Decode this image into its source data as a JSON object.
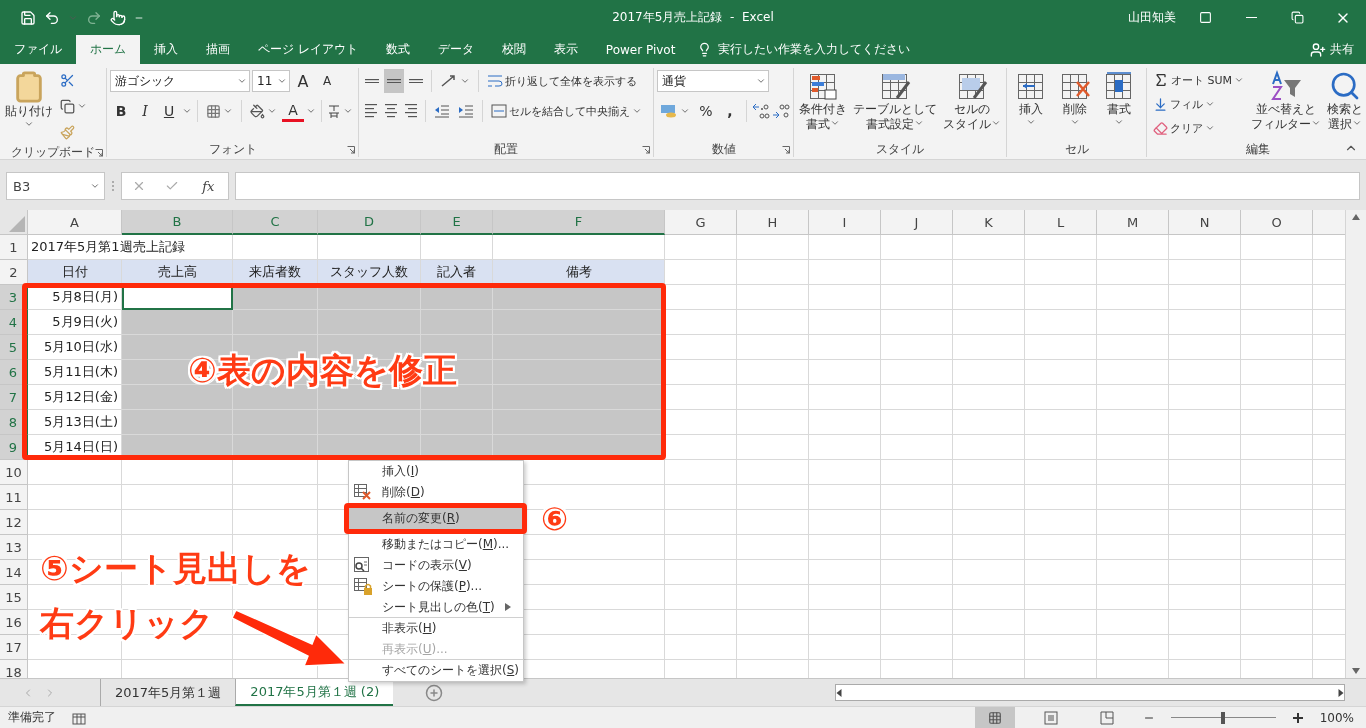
{
  "title_bar": {
    "title": "2017年5月売上記録  -  Excel",
    "user": "山田知美"
  },
  "menu_tabs": [
    {
      "label": "ファイル",
      "selected": false
    },
    {
      "label": "ホーム",
      "selected": true
    },
    {
      "label": "挿入",
      "selected": false
    },
    {
      "label": "描画",
      "selected": false
    },
    {
      "label": "ページ レイアウト",
      "selected": false
    },
    {
      "label": "数式",
      "selected": false
    },
    {
      "label": "データ",
      "selected": false
    },
    {
      "label": "校閲",
      "selected": false
    },
    {
      "label": "表示",
      "selected": false
    },
    {
      "label": "Power Pivot",
      "selected": false
    }
  ],
  "tell_me": {
    "placeholder": "実行したい作業を入力してください"
  },
  "share": "共有",
  "ribbon": {
    "clipboard": {
      "paste": "貼り付け",
      "label": "クリップボード"
    },
    "font": {
      "name": "游ゴシック",
      "size": "11",
      "grow": "A",
      "shrink": "A",
      "bold": "B",
      "italic": "I",
      "underline": "U",
      "color_glyph": "A",
      "label": "フォント"
    },
    "alignment": {
      "wrap": "折り返して全体を表示する",
      "merge": "セルを結合して中央揃え",
      "label": "配置"
    },
    "number": {
      "format": "通貨",
      "percent": "%",
      "comma": ",",
      "label": "数値"
    },
    "styles": {
      "label": "スタイル",
      "buttons": [
        {
          "kind": "conditional",
          "lines": [
            "条件付き",
            "書式"
          ]
        },
        {
          "kind": "table",
          "lines": [
            "テーブルとして",
            "書式設定"
          ]
        },
        {
          "kind": "cellstyle",
          "lines": [
            "セルの",
            "スタイル"
          ]
        }
      ]
    },
    "cells": {
      "label": "セル",
      "buttons": [
        {
          "kind": "insert",
          "lines": [
            "挿入"
          ]
        },
        {
          "kind": "delete",
          "lines": [
            "削除"
          ]
        },
        {
          "kind": "format",
          "lines": [
            "書式"
          ]
        }
      ]
    },
    "editing": {
      "label": "編集",
      "autosum": "オート SUM",
      "fill": "フィル",
      "clear": "クリア",
      "buttons": [
        {
          "kind": "sort",
          "lines": [
            "並べ替えと",
            "フィルター"
          ]
        },
        {
          "kind": "find",
          "lines": [
            "検索と",
            "選択"
          ]
        }
      ]
    }
  },
  "formula_bar": {
    "name_box": "B3",
    "function_label": "fx"
  },
  "grid": {
    "columns": [
      {
        "label": "A",
        "selected": false,
        "active": false
      },
      {
        "label": "B",
        "selected": true,
        "active": true
      },
      {
        "label": "C",
        "selected": true,
        "active": false
      },
      {
        "label": "D",
        "selected": true,
        "active": false
      },
      {
        "label": "E",
        "selected": true,
        "active": false
      },
      {
        "label": "F",
        "selected": true,
        "active": false
      },
      {
        "label": "G",
        "selected": false,
        "active": false
      },
      {
        "label": "H",
        "selected": false,
        "active": false
      },
      {
        "label": "I",
        "selected": false,
        "active": false
      },
      {
        "label": "J",
        "selected": false,
        "active": false
      },
      {
        "label": "K",
        "selected": false,
        "active": false
      },
      {
        "label": "L",
        "selected": false,
        "active": false
      },
      {
        "label": "M",
        "selected": false,
        "active": false
      },
      {
        "label": "N",
        "selected": false,
        "active": false
      },
      {
        "label": "O",
        "selected": false,
        "active": false
      }
    ],
    "rows": [
      {
        "num": "1",
        "kind": "title",
        "selected": false,
        "cells": [
          "2017年5月第1週売上記録"
        ]
      },
      {
        "num": "2",
        "kind": "header",
        "selected": false,
        "cells": [
          "日付",
          "売上高",
          "来店者数",
          "スタッフ人数",
          "記入者",
          "備考"
        ]
      },
      {
        "num": "3",
        "kind": "data",
        "selected": true,
        "cells": [
          "5月8日(月)"
        ]
      },
      {
        "num": "4",
        "kind": "data",
        "selected": true,
        "cells": [
          "5月9日(火)"
        ]
      },
      {
        "num": "5",
        "kind": "data",
        "selected": true,
        "cells": [
          "5月10日(水)"
        ]
      },
      {
        "num": "6",
        "kind": "data",
        "selected": true,
        "cells": [
          "5月11日(木)"
        ]
      },
      {
        "num": "7",
        "kind": "data",
        "selected": true,
        "cells": [
          "5月12日(金)"
        ]
      },
      {
        "num": "8",
        "kind": "data",
        "selected": true,
        "cells": [
          "5月13日(土)"
        ]
      },
      {
        "num": "9",
        "kind": "data",
        "selected": true,
        "cells": [
          "5月14日(日)"
        ]
      },
      {
        "num": "10",
        "kind": "empty",
        "selected": false
      },
      {
        "num": "11",
        "kind": "empty",
        "selected": false
      },
      {
        "num": "12",
        "kind": "empty",
        "selected": false
      },
      {
        "num": "13",
        "kind": "empty",
        "selected": false
      },
      {
        "num": "14",
        "kind": "empty",
        "selected": false
      },
      {
        "num": "15",
        "kind": "empty",
        "selected": false
      },
      {
        "num": "16",
        "kind": "empty",
        "selected": false
      },
      {
        "num": "17",
        "kind": "empty",
        "selected": false
      },
      {
        "num": "18",
        "kind": "empty",
        "selected": false
      }
    ]
  },
  "context_menu": {
    "items": [
      {
        "before": "挿入(",
        "key": "I",
        "after": ")",
        "kind": "plain",
        "selected": false,
        "disabled": false,
        "submenu": false,
        "separator_after": false
      },
      {
        "before": "削除(",
        "key": "D",
        "after": ")",
        "kind": "delete",
        "selected": false,
        "disabled": false,
        "submenu": false,
        "separator_after": false
      },
      {
        "before": "名前の変更(",
        "key": "R",
        "after": ")",
        "kind": "plain",
        "selected": true,
        "disabled": false,
        "submenu": false,
        "separator_after": false
      },
      {
        "before": "移動またはコピー(",
        "key": "M",
        "after": ")...",
        "kind": "plain",
        "selected": false,
        "disabled": false,
        "submenu": false,
        "separator_after": false
      },
      {
        "before": "コードの表示(",
        "key": "V",
        "after": ")",
        "kind": "code",
        "selected": false,
        "disabled": false,
        "submenu": false,
        "separator_after": false
      },
      {
        "before": "シートの保護(",
        "key": "P",
        "after": ")...",
        "kind": "protect",
        "selected": false,
        "disabled": false,
        "submenu": false,
        "separator_after": false
      },
      {
        "before": "シート見出しの色(",
        "key": "T",
        "after": ")",
        "kind": "plain",
        "selected": false,
        "disabled": false,
        "submenu": true,
        "separator_after": true
      },
      {
        "before": "非表示(",
        "key": "H",
        "after": ")",
        "kind": "plain",
        "selected": false,
        "disabled": false,
        "submenu": false,
        "separator_after": false
      },
      {
        "before": "再表示(",
        "key": "U",
        "after": ")...",
        "kind": "plain",
        "selected": false,
        "disabled": true,
        "submenu": false,
        "separator_after": true
      },
      {
        "before": "すべてのシートを選択(",
        "key": "S",
        "after": ")",
        "kind": "plain",
        "selected": false,
        "disabled": false,
        "submenu": false,
        "separator_after": false
      }
    ]
  },
  "sheet_tabs": [
    {
      "label": "2017年5月第１週",
      "selected": false
    },
    {
      "label": "2017年5月第１週 (2)",
      "selected": true
    }
  ],
  "status_bar": {
    "status": "準備完了",
    "zoom": {
      "level": 0.5
    },
    "zoom_label": "100%"
  },
  "annotations": [
    {
      "text": "④表の内容を修正"
    },
    {
      "text": "⑥"
    },
    {
      "text": "⑤シート見出しを"
    },
    {
      "text": "右クリック"
    }
  ]
}
